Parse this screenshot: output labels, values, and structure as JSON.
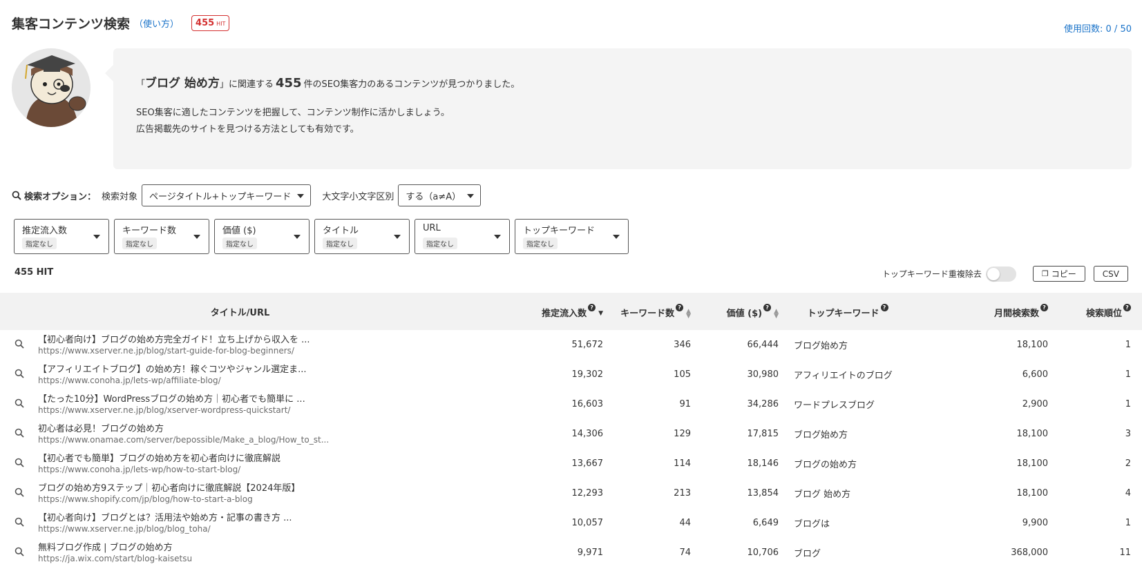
{
  "header": {
    "title": "集客コンテンツ検索",
    "help_link": "（使い方）",
    "hit_number": "455",
    "hit_unit": "HIT",
    "usage": "使用回数: 0 / 50"
  },
  "intro": {
    "quote_open": "「",
    "keyword": "ブログ 始め方",
    "quote_close": "」に関連する",
    "count": "455",
    "line1_suffix": "件のSEO集客力のあるコンテンツが見つかりました。",
    "line2": "SEO集客に適したコンテンツを把握して、コンテンツ制作に活かしましょう。",
    "line3": "広告掲載先のサイトを見つける方法としても有効です。"
  },
  "options": {
    "label": "検索オプション：",
    "target_label": "検索対象",
    "target_value": "ページタイトル+トップキーワード",
    "case_label": "大文字小文字区別",
    "case_value": "する（a≠A）"
  },
  "filters": [
    {
      "name": "推定流入数",
      "value": "指定なし"
    },
    {
      "name": "キーワード数",
      "value": "指定なし"
    },
    {
      "name": "価値 ($)",
      "value": "指定なし"
    },
    {
      "name": "タイトル",
      "value": "指定なし"
    },
    {
      "name": "URL",
      "value": "指定なし"
    },
    {
      "name": "トップキーワード",
      "value": "指定なし"
    }
  ],
  "results_bar": {
    "hit_count": "455 HIT",
    "dedupe_label": "トップキーワード重複除去",
    "copy_label": "コピー",
    "csv_label": "CSV"
  },
  "table": {
    "columns": {
      "title": "タイトル/URL",
      "traffic": "推定流入数",
      "keywords": "キーワード数",
      "value": "価値 ($)",
      "top_keyword": "トップキーワード",
      "volume": "月間検索数",
      "rank": "検索順位"
    },
    "rows": [
      {
        "title": "【初心者向け】ブログの始め方完全ガイド！立ち上げから収入を ...",
        "url": "https://www.xserver.ne.jp/blog/start-guide-for-blog-beginners/",
        "traffic": "51,672",
        "keywords": "346",
        "value": "66,444",
        "top_keyword": "ブログ始め方",
        "volume": "18,100",
        "rank": "1"
      },
      {
        "title": "【アフィリエイトブログ】の始め方！稼ぐコツやジャンル選定ま...",
        "url": "https://www.conoha.jp/lets-wp/affiliate-blog/",
        "traffic": "19,302",
        "keywords": "105",
        "value": "30,980",
        "top_keyword": "アフィリエイトのブログ",
        "volume": "6,600",
        "rank": "1"
      },
      {
        "title": "【たった10分】WordPressブログの始め方｜初心者でも簡単に ...",
        "url": "https://www.xserver.ne.jp/blog/xserver-wordpress-quickstart/",
        "traffic": "16,603",
        "keywords": "91",
        "value": "34,286",
        "top_keyword": "ワードプレスブログ",
        "volume": "2,900",
        "rank": "1"
      },
      {
        "title": "初心者は必見！ブログの始め方",
        "url": "https://www.onamae.com/server/bepossible/Make_a_blog/How_to_st...",
        "traffic": "14,306",
        "keywords": "129",
        "value": "17,815",
        "top_keyword": "ブログ始め方",
        "volume": "18,100",
        "rank": "3"
      },
      {
        "title": "【初心者でも簡単】ブログの始め方を初心者向けに徹底解説",
        "url": "https://www.conoha.jp/lets-wp/how-to-start-blog/",
        "traffic": "13,667",
        "keywords": "114",
        "value": "18,146",
        "top_keyword": "ブログの始め方",
        "volume": "18,100",
        "rank": "2"
      },
      {
        "title": "ブログの始め方9ステップ｜初心者向けに徹底解説【2024年版】",
        "url": "https://www.shopify.com/jp/blog/how-to-start-a-blog",
        "traffic": "12,293",
        "keywords": "213",
        "value": "13,854",
        "top_keyword": "ブログ 始め方",
        "volume": "18,100",
        "rank": "4"
      },
      {
        "title": "【初心者向け】ブログとは？活用法や始め方・記事の書き方 ...",
        "url": "https://www.xserver.ne.jp/blog/blog_toha/",
        "traffic": "10,057",
        "keywords": "44",
        "value": "6,649",
        "top_keyword": "ブログは",
        "volume": "9,900",
        "rank": "1"
      },
      {
        "title": "無料ブログ作成 | ブログの始め方",
        "url": "https://ja.wix.com/start/blog-kaisetsu",
        "traffic": "9,971",
        "keywords": "74",
        "value": "10,706",
        "top_keyword": "ブログ",
        "volume": "368,000",
        "rank": "11"
      }
    ]
  },
  "colors": {
    "accent": "#1a73c9",
    "badge": "#d32f2f",
    "intro_bg": "#f4f4f4",
    "header_bg": "#f2f2f2"
  }
}
